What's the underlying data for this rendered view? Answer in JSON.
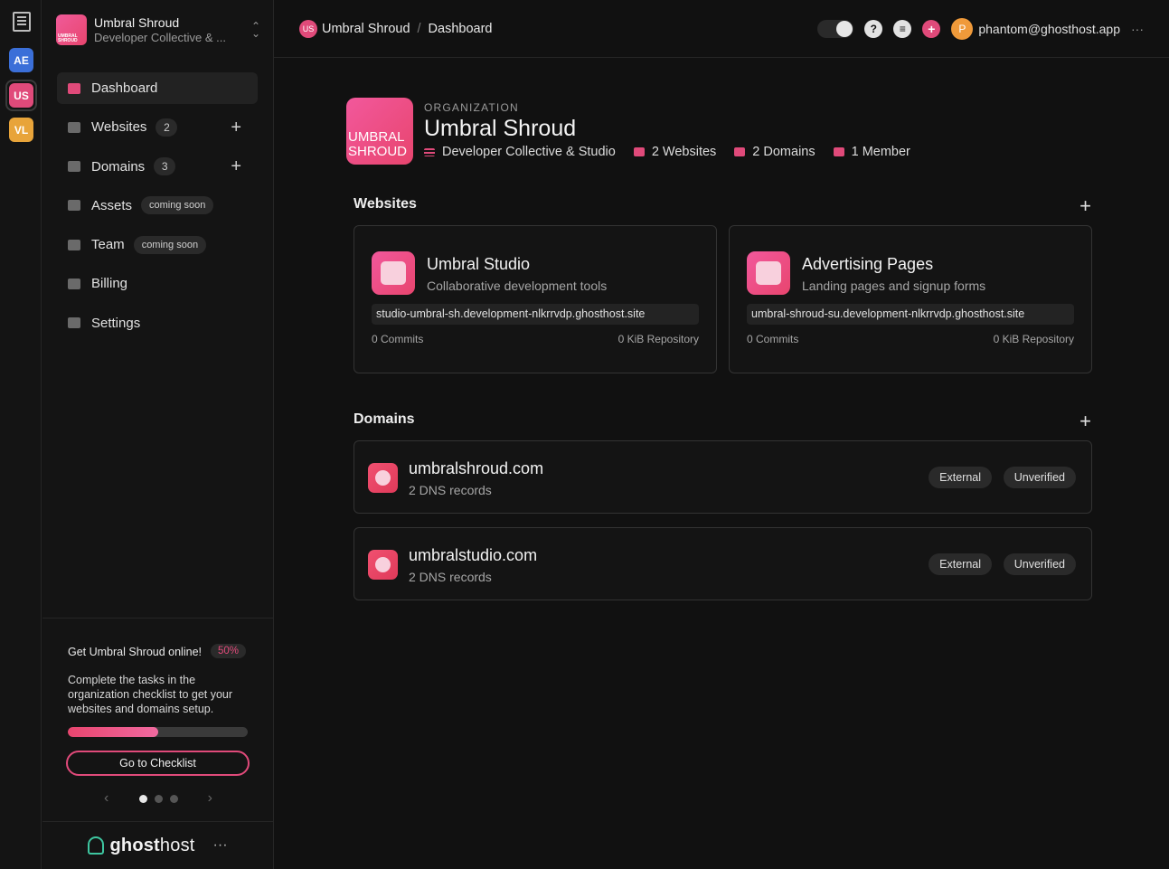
{
  "rail": {
    "items": [
      {
        "label": "AE",
        "color": "#3b6fd8"
      },
      {
        "label": "US",
        "color": "#e04a7a"
      },
      {
        "label": "VL",
        "color": "#e8a43a"
      }
    ]
  },
  "sidebar": {
    "org": {
      "name": "Umbral Shroud",
      "subtitle": "Developer Collective & ...",
      "logo_text": "UMBRAL SHROUD"
    },
    "nav": [
      {
        "label": "Dashboard",
        "icon": "dashboard-icon"
      },
      {
        "label": "Websites",
        "count": "2",
        "icon": "websites-icon"
      },
      {
        "label": "Domains",
        "count": "3",
        "icon": "domains-icon"
      },
      {
        "label": "Assets",
        "badge": "coming soon",
        "icon": "assets-icon"
      },
      {
        "label": "Team",
        "badge": "coming soon",
        "icon": "team-icon"
      },
      {
        "label": "Billing",
        "icon": "billing-icon"
      },
      {
        "label": "Settings",
        "icon": "settings-icon"
      }
    ],
    "checklist": {
      "title": "Get Umbral Shroud online!",
      "percent_label": "50%",
      "progress": 0.5,
      "body": "Complete the tasks in the organization checklist to get your websites and domains setup.",
      "button": "Go to Checklist"
    },
    "brand": {
      "name_bold": "ghost",
      "name_regular": "host",
      "more": "···"
    }
  },
  "topbar": {
    "crumb_avatar": "US",
    "crumb_org": "Umbral Shroud",
    "crumb_sep": "/",
    "crumb_page": "Dashboard",
    "help": "?",
    "add": "+",
    "user_initial": "P",
    "user_email": "phantom@ghosthost.app",
    "more": "···"
  },
  "hero": {
    "logo_text_1": "UMBRAL",
    "logo_text_2": "SHROUD",
    "kicker": "ORGANIZATION",
    "title": "Umbral Shroud",
    "meta": [
      {
        "label": "Developer Collective & Studio",
        "icon": "description-icon"
      },
      {
        "label": "2 Websites",
        "icon": "websites-icon"
      },
      {
        "label": "2 Domains",
        "icon": "domains-icon"
      },
      {
        "label": "1 Member",
        "icon": "members-icon"
      }
    ]
  },
  "websites": {
    "title": "Websites",
    "items": [
      {
        "name": "Umbral Studio",
        "description": "Collaborative development tools",
        "url": "studio-umbral-sh.development-nlkrrvdp.ghosthost.site",
        "commits": "0 Commits",
        "repo": "0 KiB Repository"
      },
      {
        "name": "Advertising Pages",
        "description": "Landing pages and signup forms",
        "url": "umbral-shroud-su.development-nlkrrvdp.ghosthost.site",
        "commits": "0 Commits",
        "repo": "0 KiB Repository"
      }
    ]
  },
  "domains": {
    "title": "Domains",
    "items": [
      {
        "name": "umbralshroud.com",
        "records": "2 DNS records",
        "badge_1": "External",
        "badge_2": "Unverified"
      },
      {
        "name": "umbralstudio.com",
        "records": "2 DNS records",
        "badge_1": "External",
        "badge_2": "Unverified"
      }
    ]
  }
}
